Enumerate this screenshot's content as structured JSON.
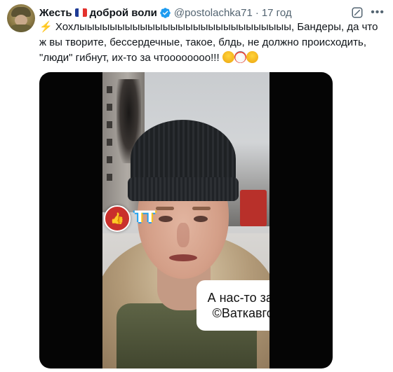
{
  "tweet": {
    "author_name": "Жесть",
    "author_name_suffix": "доброй воли",
    "handle": "@postolachka71",
    "separator": "·",
    "time": "17 год",
    "text_prefix": "⚡",
    "text": " Хохлыыыыыыыыыыыыыыыыыыыыыыыыыыыы, Бандеры, да что ж вы творите, бессердечные, такое, блдь, не должно происходить, \"люди\" гибнут, их-то за чтоооооооо!!! ",
    "emojis": [
      "scream-emoji",
      "clown-emoji",
      "scream-emoji"
    ]
  },
  "icons": {
    "verified": "verified-badge-icon",
    "flag": "france-flag-icon",
    "grok": "grok-icon",
    "more": "more-dots-icon",
    "like_badge": "thumbs-up-icon"
  },
  "media": {
    "watermark": "TT",
    "caption_line1": "А нас-то за што?",
    "caption_line2": "©Ваткавголове"
  },
  "colors": {
    "verified": "#1d9bf0",
    "muted": "#536471",
    "text": "#0f1419",
    "like_badge": "#c9302c"
  }
}
